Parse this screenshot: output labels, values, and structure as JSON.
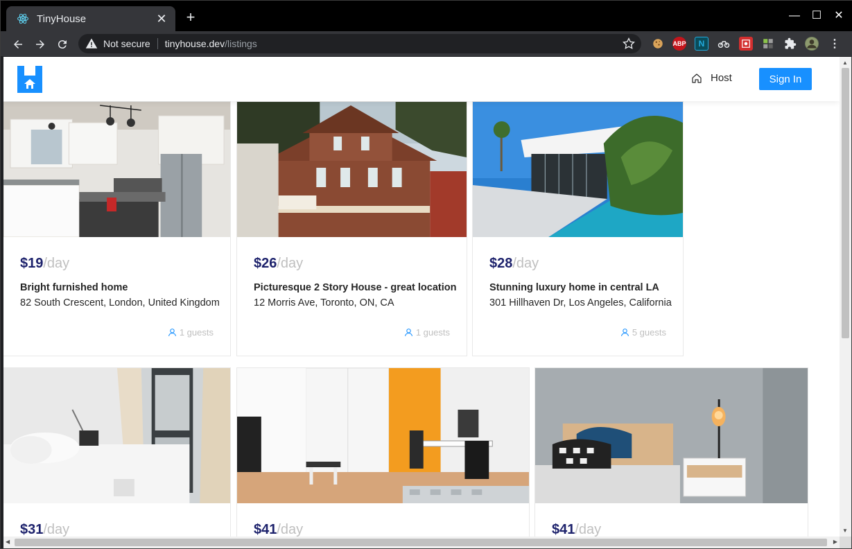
{
  "browser": {
    "tab_title": "TinyHouse",
    "close_glyph": "✕",
    "newtab_glyph": "+",
    "security_text": "Not secure",
    "url_host": "tinyhouse.dev",
    "url_path": "/listings",
    "window_controls": {
      "minimize": "—",
      "maximize": "☐",
      "close": "✕"
    }
  },
  "header": {
    "host_label": "Host",
    "signin_label": "Sign In",
    "accent": "#1890ff",
    "logo_color": "#1890ff"
  },
  "listings": [
    {
      "price": "$19",
      "per": "/day",
      "title": "Bright furnished home",
      "address": "82 South Crescent, London, United Kingdom",
      "guests": "1 guests",
      "image": "kitchen"
    },
    {
      "price": "$26",
      "per": "/day",
      "title": "Picturesque 2 Story House - great location",
      "address": "12 Morris Ave, Toronto, ON, CA",
      "guests": "1 guests",
      "image": "victorian-house"
    },
    {
      "price": "$28",
      "per": "/day",
      "title": "Stunning luxury home in central LA",
      "address": "301 Hillhaven Dr, Los Angeles, California",
      "guests": "5 guests",
      "image": "modern-villa-pool"
    },
    {
      "price": "$31",
      "per": "/day",
      "image": "white-bedroom"
    },
    {
      "price": "$41",
      "per": "/day",
      "image": "orange-wall-room"
    },
    {
      "price": "$41",
      "per": "/day",
      "image": "bedroom-nightstand"
    }
  ],
  "colors": {
    "price": "#1d226c",
    "muted": "#bfbfbf",
    "icon_blue": "#1890ff"
  }
}
